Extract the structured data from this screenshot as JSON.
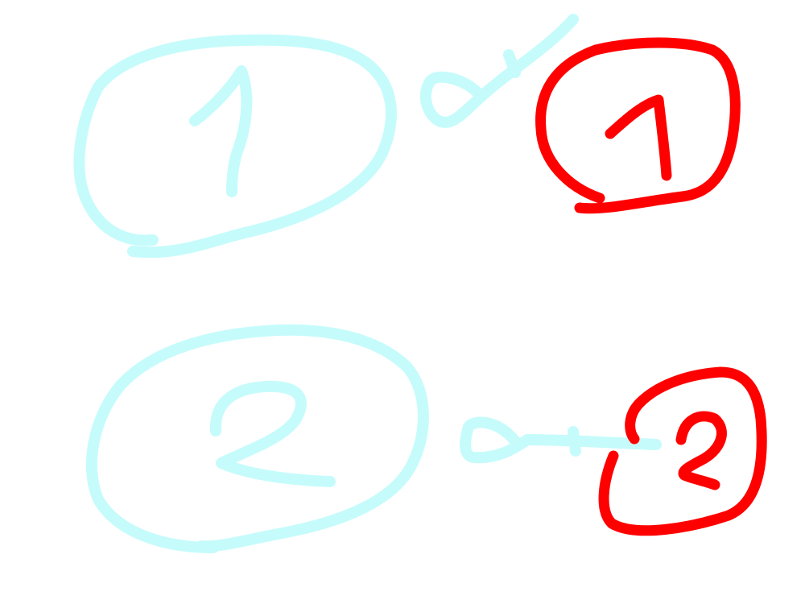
{
  "drawing": {
    "background": "#ffffff",
    "pairs": [
      {
        "left": {
          "digit": "1",
          "color": "#c6fbfb"
        },
        "connector_color": "#c6fbfb",
        "right": {
          "digit": "1",
          "color": "#ff0000"
        }
      },
      {
        "left": {
          "digit": "2",
          "color": "#c6fbfb"
        },
        "connector_color": "#c6fbfb",
        "right": {
          "digit": "2",
          "color": "#ff0000"
        }
      }
    ]
  }
}
